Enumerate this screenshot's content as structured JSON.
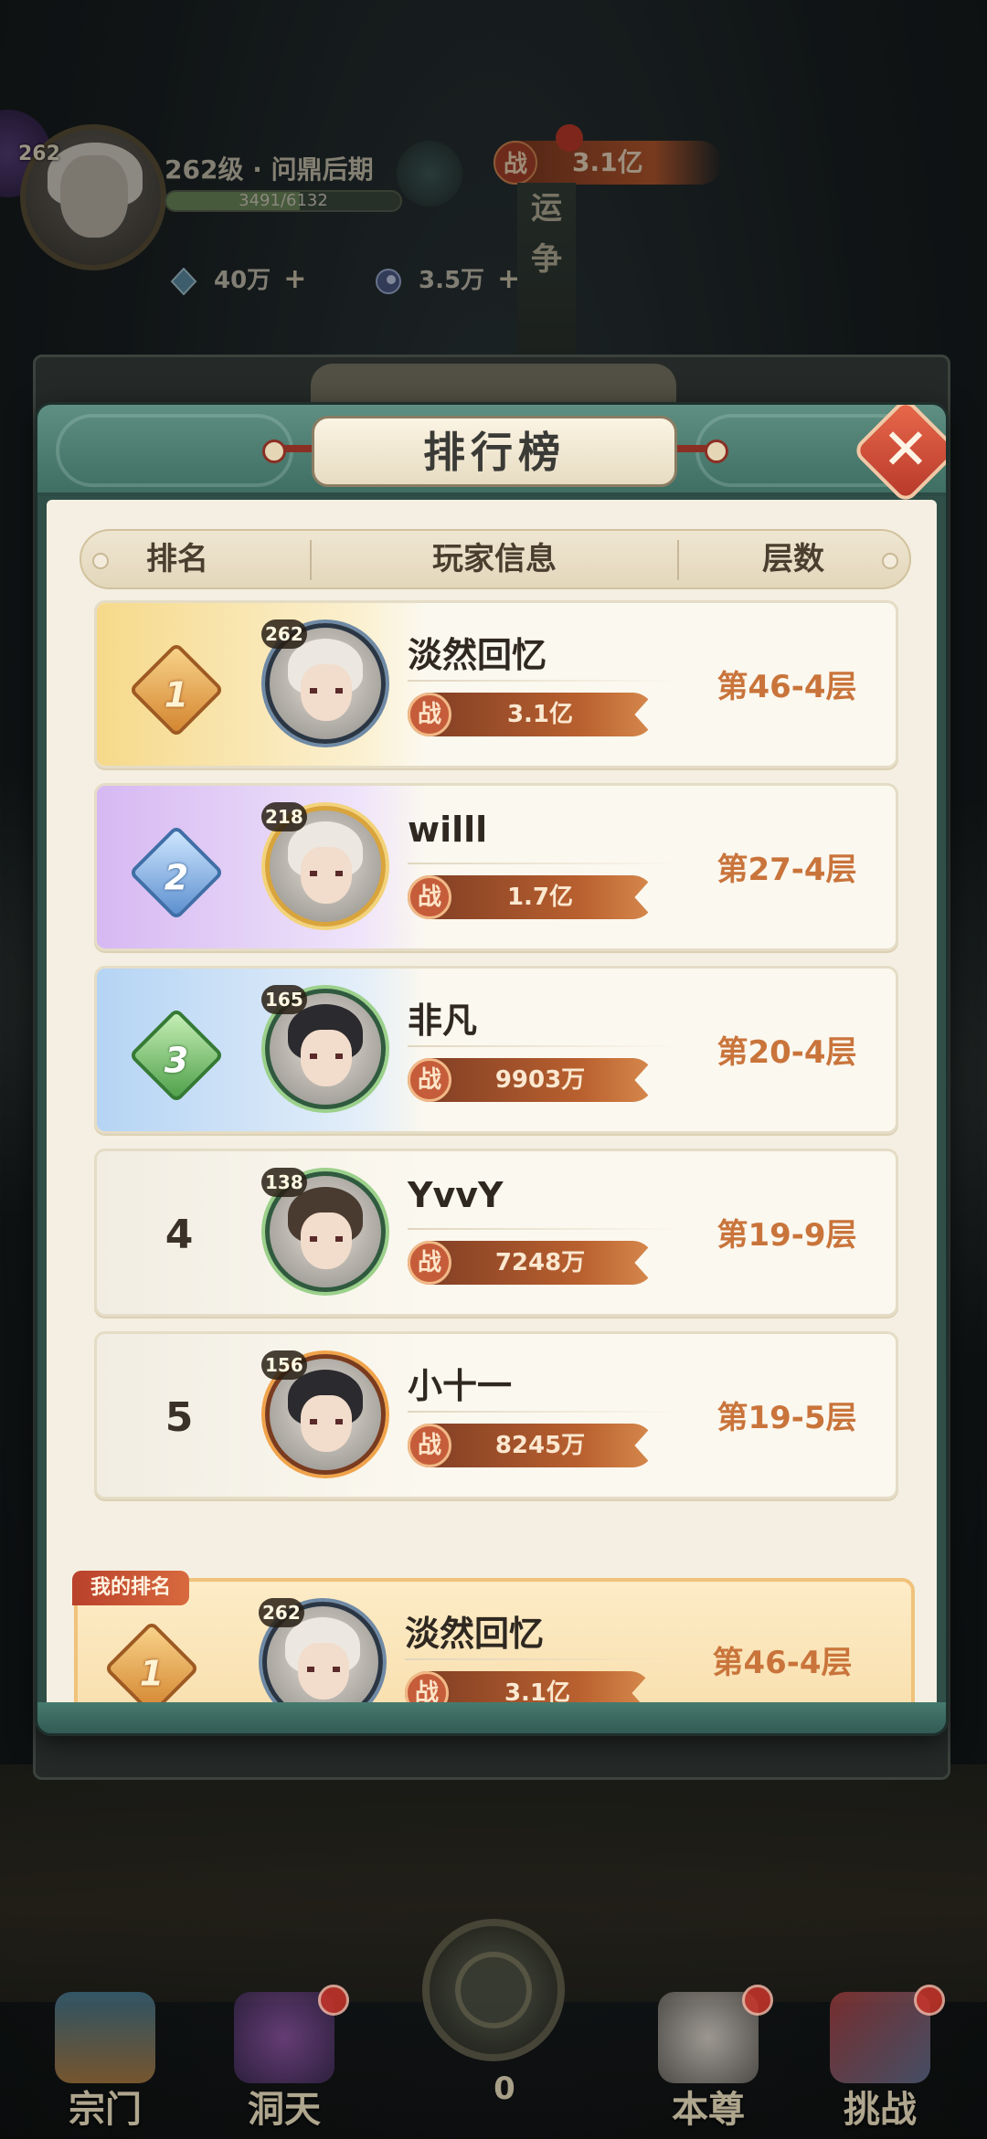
{
  "hud": {
    "level_badge": "262",
    "title": "262级 · 问鼎后期",
    "xp_text": "3491/6132",
    "xp_fraction": 0.569,
    "res1": "40万",
    "res2": "3.5万",
    "plus": "+",
    "power_label": "战",
    "power_value": "3.1亿",
    "pillar": [
      "运",
      "争"
    ]
  },
  "modal": {
    "title": "排行榜",
    "close_icon": "close-icon",
    "columns": [
      "排名",
      "玩家信息",
      "层数"
    ]
  },
  "power_label": "战",
  "rows": [
    {
      "rank": "1",
      "style": "gold",
      "level": "262",
      "name": "淡然回忆",
      "power": "3.1亿",
      "floor": "第46-4层"
    },
    {
      "rank": "2",
      "style": "purple",
      "level": "218",
      "name": "willl",
      "power": "1.7亿",
      "floor": "第27-4层"
    },
    {
      "rank": "3",
      "style": "blue",
      "level": "165",
      "name": "非凡",
      "power": "9903万",
      "floor": "第20-4层"
    },
    {
      "rank": "4",
      "style": "plain",
      "level": "138",
      "name": "YvvY",
      "power": "7248万",
      "floor": "第19-9层"
    },
    {
      "rank": "5",
      "style": "plain",
      "level": "156",
      "name": "小十一",
      "power": "8245万",
      "floor": "第19-5层"
    }
  ],
  "my_rank": {
    "tag": "我的排名",
    "rank": "1",
    "level": "262",
    "name": "淡然回忆",
    "power": "3.1亿",
    "floor": "第46-4层"
  },
  "nav": {
    "items": [
      "宗门",
      "洞天",
      "本尊",
      "挑战"
    ],
    "center_value": "0"
  }
}
